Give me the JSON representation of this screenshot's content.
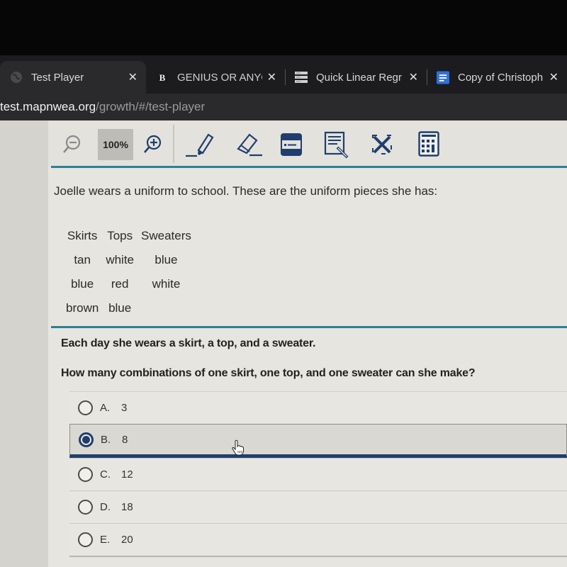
{
  "browser": {
    "tabs": [
      {
        "title": "Test Player",
        "favicon": "globe-icon",
        "active": true
      },
      {
        "title": "GENIUS OR ANYO",
        "favicon": "b-logo-icon",
        "active": false
      },
      {
        "title": "Quick Linear Regr",
        "favicon": "server-stack-icon",
        "active": false
      },
      {
        "title": "Copy of Christoph",
        "favicon": "google-docs-icon",
        "active": false
      }
    ],
    "close_glyph": "✕",
    "url_host": "test.mapnwea.org",
    "url_path": "/growth/#/test-player"
  },
  "toolbar": {
    "zoom_level": "100%",
    "tools": [
      "zoom-out",
      "zoom-in",
      "highlighter",
      "eraser",
      "line-reader",
      "notepad",
      "answer-eliminator",
      "calculator"
    ]
  },
  "question": {
    "stem": "Joelle wears a uniform to school. These are the uniform pieces she has:",
    "table": {
      "headers": [
        "Skirts",
        "Tops",
        "Sweaters"
      ],
      "rows": [
        [
          "tan",
          "white",
          "blue"
        ],
        [
          "blue",
          "red",
          "white"
        ],
        [
          "brown",
          "blue",
          ""
        ]
      ]
    },
    "context": "Each day she wears a skirt, a top, and a sweater.",
    "prompt": "How many combinations of one skirt, one top, and one sweater can she make?",
    "choices": [
      {
        "letter": "A.",
        "value": "3",
        "selected": false
      },
      {
        "letter": "B.",
        "value": "8",
        "selected": true
      },
      {
        "letter": "C.",
        "value": "12",
        "selected": false
      },
      {
        "letter": "D.",
        "value": "18",
        "selected": false
      },
      {
        "letter": "E.",
        "value": "20",
        "selected": false
      }
    ]
  },
  "colors": {
    "accent_teal": "#2f7f94",
    "selection_navy": "#1f3e6e",
    "page_background": "#e6e5df"
  }
}
